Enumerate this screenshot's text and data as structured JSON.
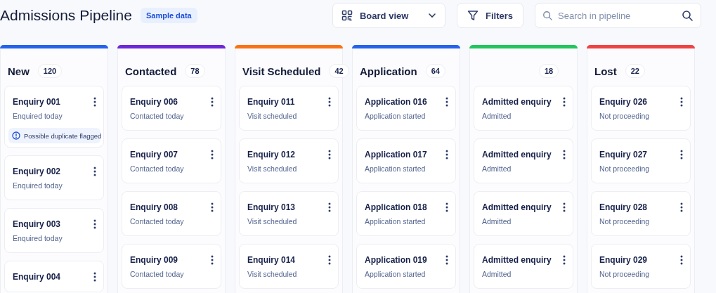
{
  "header": {
    "title": "Admissions Pipeline",
    "badge": "Sample data",
    "view_button": "Board view",
    "filters_button": "Filters",
    "search": {
      "placeholder": "Search in pipeline"
    }
  },
  "columns": [
    {
      "name": "New",
      "count": "120",
      "color": "#2563eb",
      "cards": [
        {
          "title": "Enquiry 001",
          "subtitle": "Enquired today",
          "note": "Possible duplicate flagged"
        },
        {
          "title": "Enquiry 002",
          "subtitle": "Enquired today"
        },
        {
          "title": "Enquiry 003",
          "subtitle": "Enquired today"
        },
        {
          "title": "Enquiry 004"
        }
      ]
    },
    {
      "name": "Contacted",
      "count": "78",
      "color": "#6d28d9",
      "cards": [
        {
          "title": "Enquiry 006",
          "subtitle": "Contacted today"
        },
        {
          "title": "Enquiry 007",
          "subtitle": "Contacted today"
        },
        {
          "title": "Enquiry 008",
          "subtitle": "Contacted today"
        },
        {
          "title": "Enquiry 009",
          "subtitle": "Contacted today"
        }
      ]
    },
    {
      "name": "Visit Scheduled",
      "count": "42",
      "color": "#f97316",
      "cards": [
        {
          "title": "Enquiry 011",
          "subtitle": "Visit scheduled"
        },
        {
          "title": "Enquiry 012",
          "subtitle": "Visit scheduled"
        },
        {
          "title": "Enquiry 013",
          "subtitle": "Visit scheduled"
        },
        {
          "title": "Enquiry 014",
          "subtitle": "Visit scheduled"
        }
      ]
    },
    {
      "name": "Application",
      "count": "64",
      "color": "#2563eb",
      "cards": [
        {
          "title": "Application 016",
          "subtitle": "Application started"
        },
        {
          "title": "Application 017",
          "subtitle": "Application started"
        },
        {
          "title": "Application 018",
          "subtitle": "Application started"
        },
        {
          "title": "Application 019",
          "subtitle": "Application started"
        }
      ]
    },
    {
      "count": "18",
      "color": "#22c55e",
      "cards": [
        {
          "title": "Admitted enquiry",
          "subtitle": "Admitted"
        },
        {
          "title": "Admitted enquiry",
          "subtitle": "Admitted"
        },
        {
          "title": "Admitted enquiry",
          "subtitle": "Admitted"
        },
        {
          "title": "Admitted enquiry",
          "subtitle": "Admitted"
        }
      ]
    },
    {
      "name": "Lost",
      "count": "22",
      "color": "#ef4444",
      "cards": [
        {
          "title": "Enquiry 026",
          "subtitle": "Not proceeding"
        },
        {
          "title": "Enquiry 027",
          "subtitle": "Not proceeding"
        },
        {
          "title": "Enquiry 028",
          "subtitle": "Not proceeding"
        },
        {
          "title": "Enquiry 029",
          "subtitle": "Not proceeding"
        }
      ]
    }
  ]
}
